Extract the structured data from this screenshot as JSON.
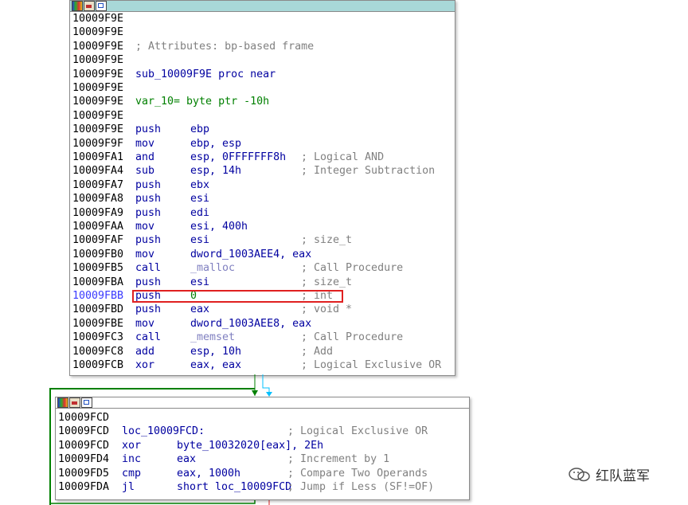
{
  "node1": {
    "lines": [
      {
        "addr": "10009F9E",
        "mnem": "",
        "ops": "",
        "comment": ""
      },
      {
        "addr": "10009F9E",
        "mnem": "",
        "ops": "",
        "comment": ""
      },
      {
        "addr": "10009F9E",
        "mnem": "",
        "ops": "",
        "comment": "; Attributes: bp-based frame"
      },
      {
        "addr": "10009F9E",
        "mnem": "",
        "ops": "",
        "comment": ""
      },
      {
        "addr": "10009F9E",
        "mnem": "sub_10009F9E proc near",
        "ops": "",
        "comment": ""
      },
      {
        "addr": "10009F9E",
        "mnem": "",
        "ops": "",
        "comment": ""
      },
      {
        "addr": "10009F9E",
        "mnem": "var_10= byte ptr -10h",
        "ops": "",
        "comment": ""
      },
      {
        "addr": "10009F9E",
        "mnem": "",
        "ops": "",
        "comment": ""
      },
      {
        "addr": "10009F9E",
        "mnem": "push",
        "ops": "ebp",
        "comment": ""
      },
      {
        "addr": "10009F9F",
        "mnem": "mov",
        "ops": "ebp, esp",
        "comment": ""
      },
      {
        "addr": "10009FA1",
        "mnem": "and",
        "ops": "esp, 0FFFFFFF8h",
        "comment": "; Logical AND"
      },
      {
        "addr": "10009FA4",
        "mnem": "sub",
        "ops": "esp, 14h",
        "comment": "; Integer Subtraction"
      },
      {
        "addr": "10009FA7",
        "mnem": "push",
        "ops": "ebx",
        "comment": ""
      },
      {
        "addr": "10009FA8",
        "mnem": "push",
        "ops": "esi",
        "comment": ""
      },
      {
        "addr": "10009FA9",
        "mnem": "push",
        "ops": "edi",
        "comment": ""
      },
      {
        "addr": "10009FAA",
        "mnem": "mov",
        "ops": "esi, 400h",
        "comment": ""
      },
      {
        "addr": "10009FAF",
        "mnem": "push",
        "ops": "esi",
        "comment": "; size_t"
      },
      {
        "addr": "10009FB0",
        "mnem": "mov",
        "ops": "dword_1003AEE4, eax",
        "comment": ""
      },
      {
        "addr": "10009FB5",
        "mnem": "call",
        "ops": "_malloc",
        "comment": "; Call Procedure"
      },
      {
        "addr": "10009FBA",
        "mnem": "push",
        "ops": "esi",
        "comment": "; size_t"
      },
      {
        "addr": "10009FBB",
        "mnem": "push",
        "ops": "0",
        "comment": "; int"
      },
      {
        "addr": "10009FBD",
        "mnem": "push",
        "ops": "eax",
        "comment": "; void *"
      },
      {
        "addr": "10009FBE",
        "mnem": "mov",
        "ops": "dword_1003AEE8, eax",
        "comment": ""
      },
      {
        "addr": "10009FC3",
        "mnem": "call",
        "ops": "_memset",
        "comment": "; Call Procedure"
      },
      {
        "addr": "10009FC8",
        "mnem": "add",
        "ops": "esp, 10h",
        "comment": "; Add"
      },
      {
        "addr": "10009FCB",
        "mnem": "xor",
        "ops": "eax, eax",
        "comment": "; Logical Exclusive OR"
      }
    ]
  },
  "node2": {
    "lines": [
      {
        "addr": "10009FCD",
        "mnem": "",
        "ops": "",
        "comment": ""
      },
      {
        "addr": "10009FCD",
        "mnem": "loc_10009FCD:",
        "ops": "",
        "comment": "; Logical Exclusive OR"
      },
      {
        "addr": "10009FCD",
        "mnem": "xor",
        "ops": "byte_10032020[eax], 2Eh",
        "comment": ""
      },
      {
        "addr": "10009FD4",
        "mnem": "inc",
        "ops": "eax",
        "comment": "; Increment by 1"
      },
      {
        "addr": "10009FD5",
        "mnem": "cmp",
        "ops": "eax, 1000h",
        "comment": "; Compare Two Operands"
      },
      {
        "addr": "10009FDA",
        "mnem": "jl",
        "ops": "short loc_10009FCD",
        "comment": "; Jump if Less (SF!=OF)"
      }
    ]
  },
  "watermark": "红队蓝军",
  "colors": {
    "header": "#a8d8d8",
    "highlight": "#e02020",
    "edge_green": "#008000",
    "edge_cyan": "#00c0ff"
  }
}
